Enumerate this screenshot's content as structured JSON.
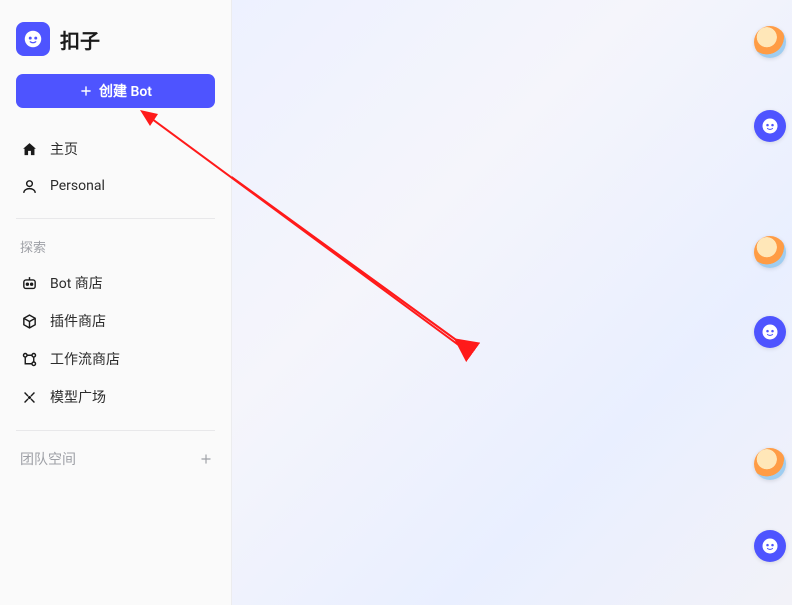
{
  "brand": {
    "title": "扣子"
  },
  "create_button": {
    "label": "创建 Bot"
  },
  "nav": {
    "primary": [
      {
        "label": "主页"
      },
      {
        "label": "Personal"
      }
    ]
  },
  "explore": {
    "heading": "探索",
    "items": [
      {
        "label": "Bot 商店"
      },
      {
        "label": "插件商店"
      },
      {
        "label": "工作流商店"
      },
      {
        "label": "模型广场"
      }
    ]
  },
  "team": {
    "heading": "团队空间"
  }
}
